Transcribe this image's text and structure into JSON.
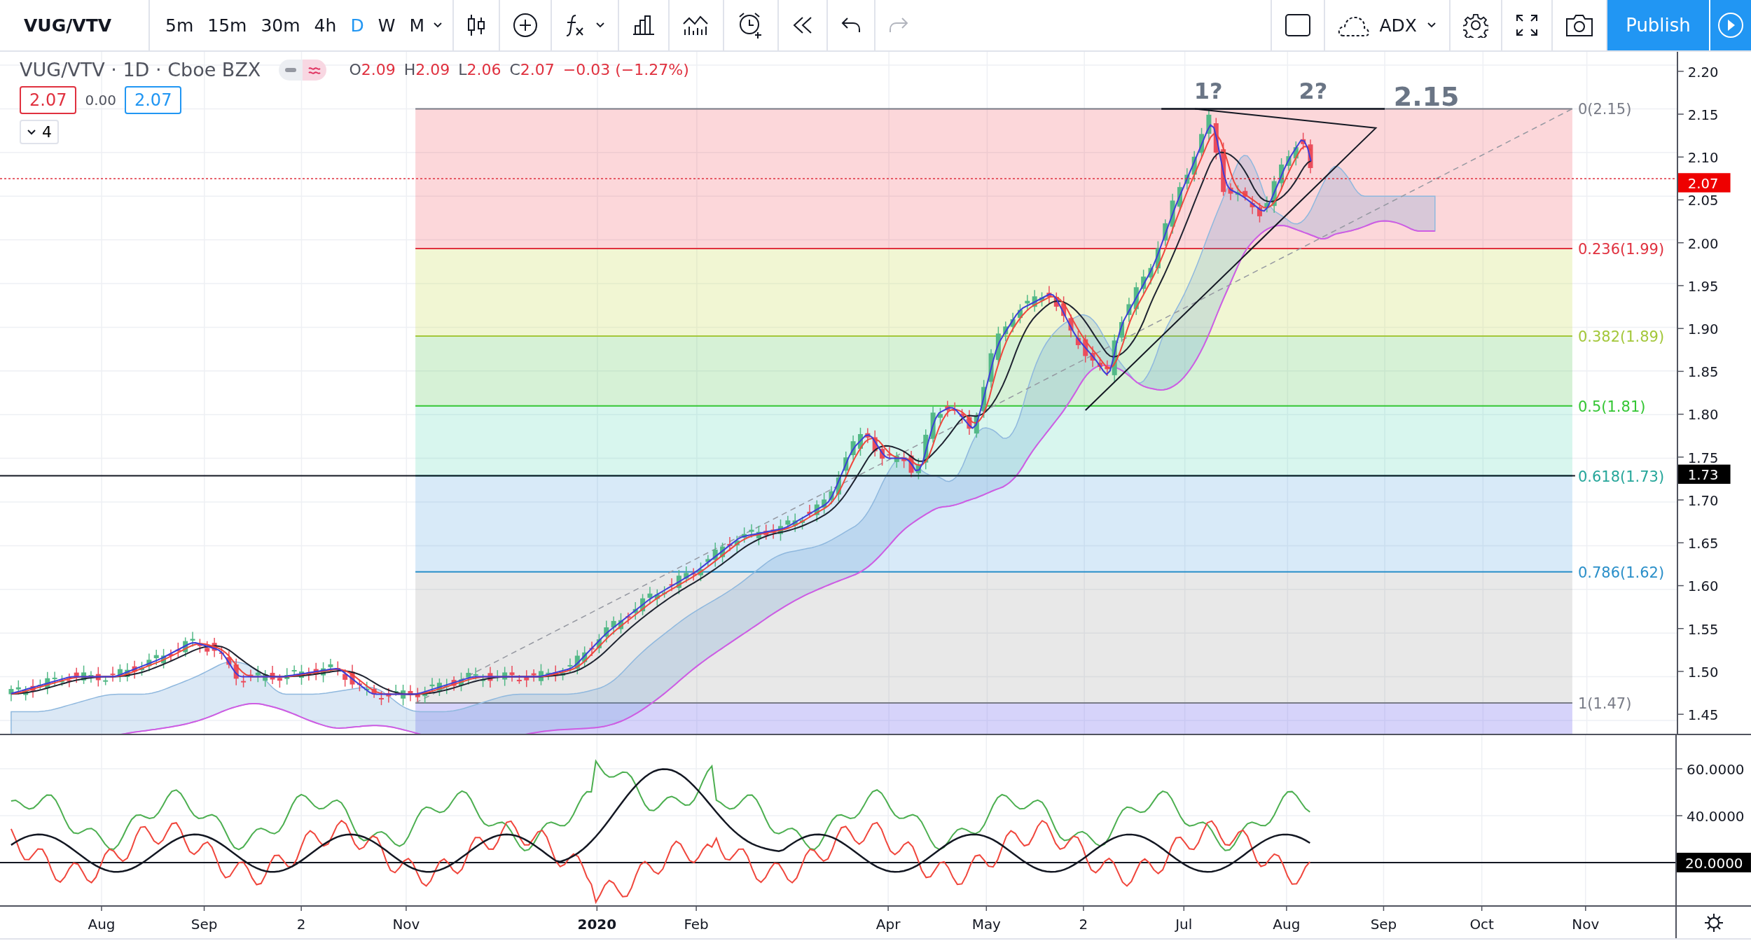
{
  "toolbar": {
    "symbol": "VUG/VTV",
    "intervals": [
      {
        "label": "5m",
        "selected": false
      },
      {
        "label": "15m",
        "selected": false
      },
      {
        "label": "30m",
        "selected": false
      },
      {
        "label": "4h",
        "selected": false
      },
      {
        "label": "D",
        "selected": true
      },
      {
        "label": "W",
        "selected": false
      },
      {
        "label": "M",
        "selected": false
      }
    ],
    "indicator": "ADX",
    "publish": "Publish"
  },
  "legend": {
    "title": "VUG/VTV · 1D · Cboe BZX",
    "ohlc": [
      {
        "key": "O",
        "value": "2.09"
      },
      {
        "key": "H",
        "value": "2.09"
      },
      {
        "key": "L",
        "value": "2.06"
      },
      {
        "key": "C",
        "value": "2.07"
      }
    ],
    "change": "−0.03 (−1.27%)",
    "bid": "2.07",
    "spread": "0.00",
    "ask": "2.07",
    "collapse": "4"
  },
  "annotations": [
    "1?",
    "2?",
    "2.15"
  ],
  "fib_levels": [
    {
      "label": "0(2.15)",
      "color": "#787b86"
    },
    {
      "label": "0.236(1.99)",
      "color": "#e0313f"
    },
    {
      "label": "0.382(1.89)",
      "color": "#a3c73a"
    },
    {
      "label": "0.5(1.81)",
      "color": "#34c634"
    },
    {
      "label": "0.618(1.73)",
      "color": "#26a69a"
    },
    {
      "label": "0.786(1.62)",
      "color": "#2a8fc9"
    },
    {
      "label": "1(1.47)",
      "color": "#787b86"
    }
  ],
  "price_axis": {
    "ticks": [
      "2.20",
      "2.15",
      "2.10",
      "2.05",
      "2.00",
      "1.95",
      "1.90",
      "1.85",
      "1.80",
      "1.75",
      "1.70",
      "1.65",
      "1.60",
      "1.55",
      "1.50",
      "1.45"
    ],
    "last_price": "2.07",
    "line_price": "1.73"
  },
  "indicator_axis": {
    "ticks": [
      "60.0000",
      "40.0000"
    ],
    "marker": "20.0000"
  },
  "time_axis": [
    {
      "label": "Aug",
      "bold": false
    },
    {
      "label": "Sep",
      "bold": false
    },
    {
      "label": "2",
      "bold": false
    },
    {
      "label": "Nov",
      "bold": false
    },
    {
      "label": "2020",
      "bold": true
    },
    {
      "label": "Feb",
      "bold": false
    },
    {
      "label": "Apr",
      "bold": false
    },
    {
      "label": "May",
      "bold": false
    },
    {
      "label": "2",
      "bold": false
    },
    {
      "label": "Jul",
      "bold": false
    },
    {
      "label": "Aug",
      "bold": false
    },
    {
      "label": "Sep",
      "bold": false
    },
    {
      "label": "Oct",
      "bold": false
    },
    {
      "label": "Nov",
      "bold": false
    }
  ]
}
